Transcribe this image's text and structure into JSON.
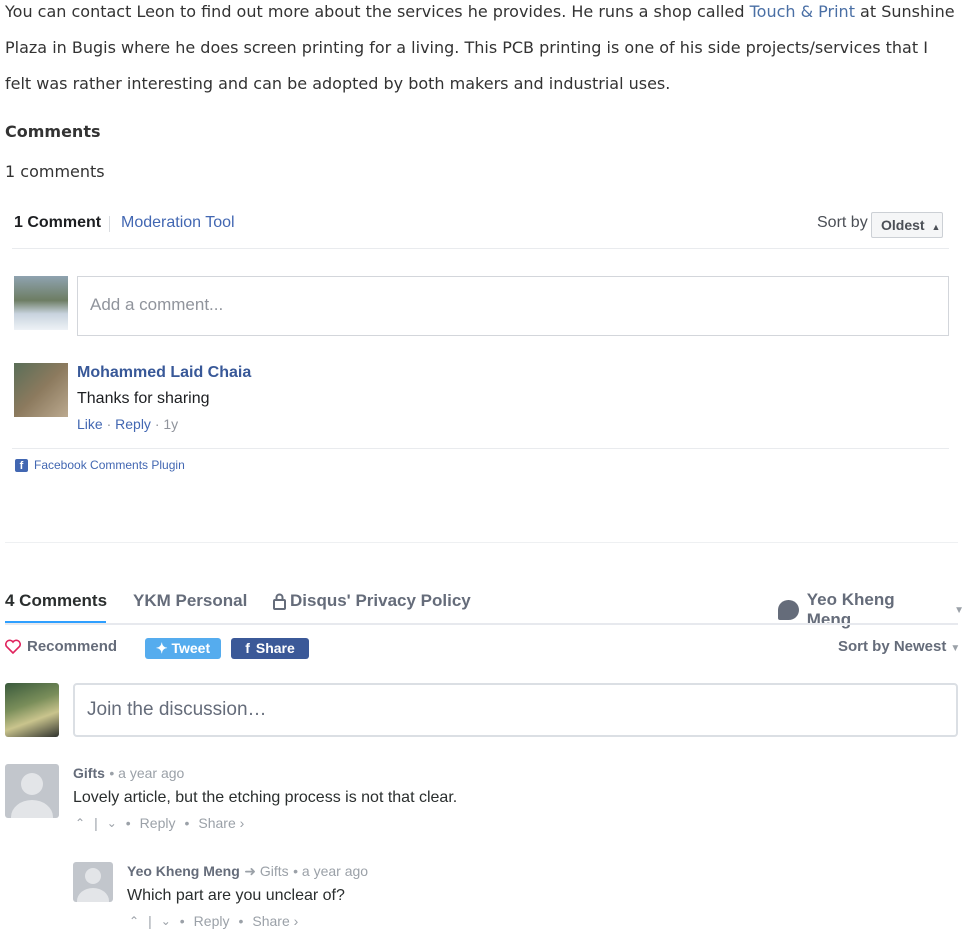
{
  "article": {
    "text_before_link": "You can contact Leon to find out more about the services he provides. He runs a shop called ",
    "link_text": "Touch & Print",
    "text_after_link": " at Sunshine Plaza in Bugis where he does screen printing for a living. This PCB printing is one of his side projects/services that I felt was rather interesting and can be adopted by both makers and industrial uses."
  },
  "comments_section": {
    "heading": "Comments",
    "count_text": "1 comments"
  },
  "facebook": {
    "count": "1 Comment",
    "moderation": "Moderation Tool",
    "sort_label": "Sort by",
    "sort_value": "Oldest",
    "input_placeholder": "Add a comment...",
    "comment": {
      "author": "Mohammed Laid Chaia",
      "text": "Thanks for sharing",
      "like": "Like",
      "reply": "Reply",
      "age": "1y"
    },
    "plugin_label": "Facebook Comments Plugin",
    "colors": {
      "link": "#4267b2",
      "name": "#385898"
    }
  },
  "disqus": {
    "tabs": [
      {
        "label": "4 Comments"
      },
      {
        "label": "YKM Personal"
      },
      {
        "label": "Disqus' Privacy Policy"
      }
    ],
    "user": "Yeo Kheng Meng",
    "recommend": "Recommend",
    "tweet": "Tweet",
    "share": "Share",
    "sort": "Sort by Newest",
    "input_placeholder": "Join the discussion…",
    "comments": [
      {
        "author": "Gifts",
        "time": "a year ago",
        "text": "Lovely article, but the etching process is not that clear.",
        "reply": "Reply",
        "share": "Share ›"
      },
      {
        "author": "Yeo Kheng Meng",
        "reply_to": "Gifts",
        "time": "a year ago",
        "text": "Which part are you unclear of?",
        "reply": "Reply",
        "share": "Share ›"
      }
    ],
    "colors": {
      "accent": "#2e9fff",
      "tweet": "#55acee",
      "facebook": "#3b5998",
      "heart": "#e0245e"
    }
  }
}
